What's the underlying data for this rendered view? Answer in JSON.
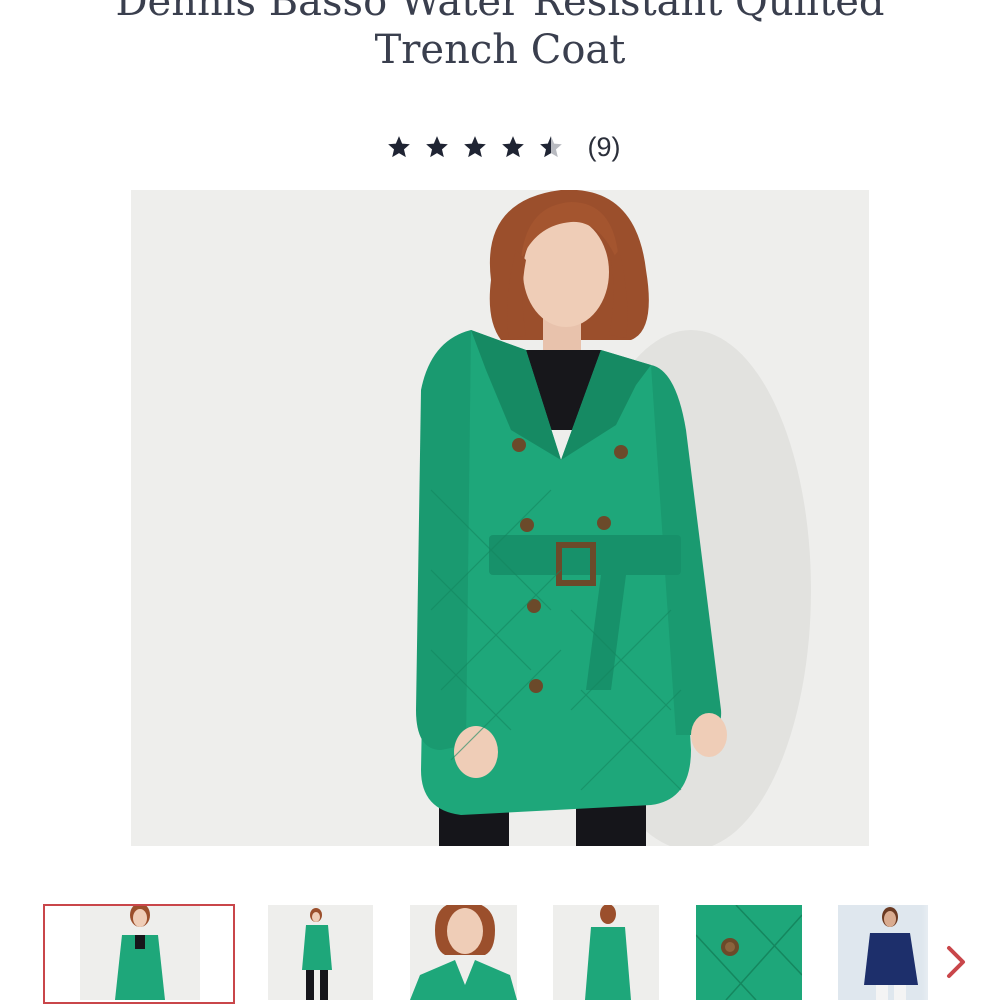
{
  "product": {
    "title_line1": "Dennis Basso Water Resistant Quilted",
    "title_line2": "Trench Coat"
  },
  "rating": {
    "value": 4.5,
    "max": 5,
    "count_label": "(9)"
  },
  "colors": {
    "coat": "#1ea77a",
    "coat_dark": "#168a63",
    "star_filled": "#1f2433",
    "star_empty": "#b8bac0",
    "selected_border": "#c9464a",
    "arrow": "#c9464a",
    "navy_coat": "#1d2f6b"
  },
  "gallery": {
    "thumbnail_count": 6,
    "selected_index": 0
  },
  "icons": {
    "star": "star-icon",
    "next": "chevron-right-icon"
  }
}
